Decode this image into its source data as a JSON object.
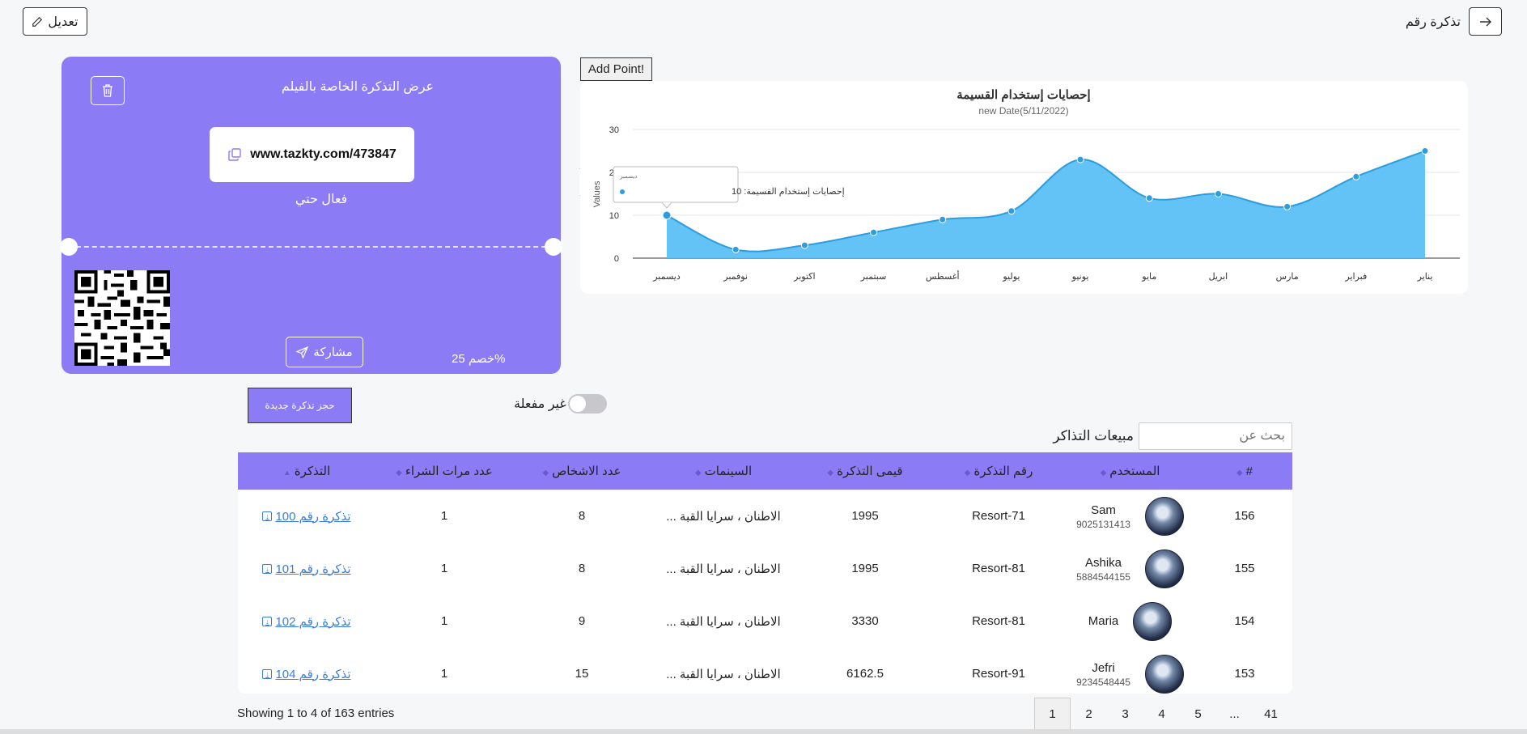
{
  "header": {
    "edit_label": "تعديل",
    "back_label": "تذكرة رقم"
  },
  "ticket": {
    "title": "عرض التذكرة الخاصة بالفيلم",
    "url": "www.tazkty.com/473847",
    "valid_until": "فعال حتي",
    "share_label": "مشاركة",
    "discount": "خصم 25%"
  },
  "chart_controls": {
    "add_point_label": "Add Point!"
  },
  "chart_data": {
    "type": "area",
    "title": "إحصايات إستخدام القسيمة",
    "subtitle": "new Date(5/11/2022)",
    "ylabel": "Values",
    "ylim": [
      0,
      30
    ],
    "yticks": [
      0,
      10,
      20,
      30
    ],
    "categories": [
      "ديسمبر",
      "نوفمبر",
      "اكتوبر",
      "سبتمبر",
      "أغسطس",
      "يوليو",
      "يونيو",
      "مايو",
      "ابريل",
      "مارس",
      "فبراير",
      "يناير"
    ],
    "series": [
      {
        "name": "إحصايات إستخدام القسيمة",
        "values": [
          10,
          2,
          3,
          6,
          9,
          11,
          23,
          14,
          15,
          12,
          19,
          25
        ]
      }
    ],
    "tooltip": {
      "category": "ديسمبر",
      "series": "إحصايات إستخدام القسيمة",
      "value": "10"
    },
    "color": "#5bbff5"
  },
  "controls": {
    "new_ticket_label": "حجز تذكرة جديدة",
    "toggle_label": "غير مفعلة",
    "search_label": "مبيعات التذاكر",
    "search_placeholder": "بحث عن"
  },
  "table": {
    "headers": [
      "#",
      "المستخدم",
      "رقم التذكرة",
      "قيمى التذكرة",
      "السينمات",
      "عدد الاشخاص",
      "عدد مرات الشراء",
      "التذكرة"
    ],
    "rows": [
      {
        "id": "156",
        "name": "Sam",
        "phone": "9025131413",
        "ticket_no": "Resort-71",
        "value": "1995",
        "cinema": "الاطنان ، سرايا القبة ...",
        "persons": "8",
        "purchases": "1",
        "ticket_link": "تذكرة رقم 100"
      },
      {
        "id": "155",
        "name": "Ashika",
        "phone": "5884544155",
        "ticket_no": "Resort-81",
        "value": "1995",
        "cinema": "الاطنان ، سرايا القبة ...",
        "persons": "8",
        "purchases": "1",
        "ticket_link": "تذكرة رقم 101"
      },
      {
        "id": "154",
        "name": "Maria",
        "phone": "",
        "ticket_no": "Resort-81",
        "value": "3330",
        "cinema": "الاطنان ، سرايا القبة ...",
        "persons": "9",
        "purchases": "1",
        "ticket_link": "تذكرة رقم 102"
      },
      {
        "id": "153",
        "name": "Jefri",
        "phone": "9234548445",
        "ticket_no": "Resort-91",
        "value": "6162.5",
        "cinema": "الاطنان ، سرايا القبة ...",
        "persons": "15",
        "purchases": "1",
        "ticket_link": "تذكرة رقم 104"
      }
    ]
  },
  "footer": {
    "showing": "Showing 1 to 4 of 163 entries",
    "pages": [
      "1",
      "2",
      "3",
      "4",
      "5",
      "...",
      "41"
    ],
    "active_page": "1"
  }
}
